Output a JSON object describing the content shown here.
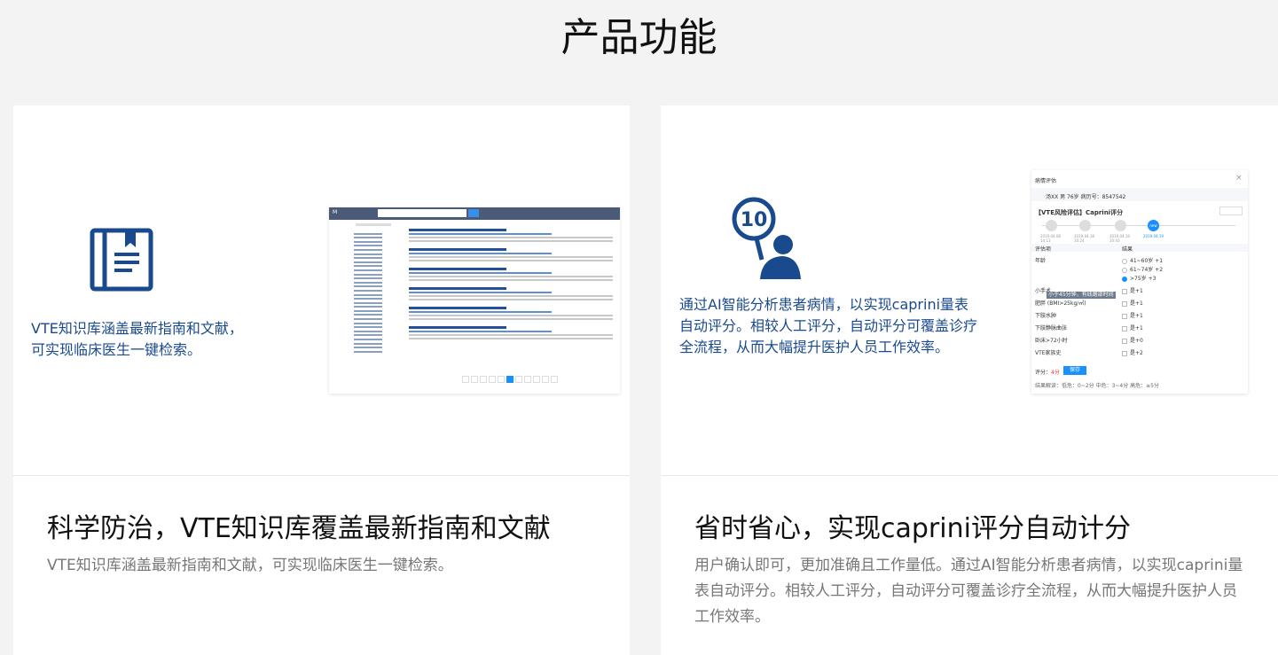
{
  "page": {
    "title": "产品功能"
  },
  "left_card": {
    "hero_text": [
      "VTE知识库涵盖最新指南和文献，",
      "可实现临床医生一键检索。"
    ],
    "heading": "科学防治，VTE知识库覆盖最新指南和文献",
    "description": "VTE知识库涵盖最新指南和文献，可实现临床医生一键检索。",
    "icon": "book-icon"
  },
  "right_card": {
    "hero_text": [
      "通过AI智能分析患者病情，以实现caprini量表",
      "自动评分。相较人工评分，自动评分可覆盖诊疗",
      "全流程，从而大幅提升医护人员工作效率。"
    ],
    "heading": "省时省心，实现caprini评分自动计分",
    "description": "用户确认即可，更加准确且工作量低。通过AI智能分析患者病情，以实现caprini量表自动评分。相较人工评分，自动评分可覆盖诊疗全流程，从而大幅提升医护人员工作效率。",
    "icon": "score-paddle-icon",
    "icon_number": "10"
  },
  "screenshot_right": {
    "title": "病情评估",
    "close": "×",
    "patient": "汤XX  男  76岁  病历号：8547542",
    "section": "【VTE风险评估】Caprini评分",
    "dates": [
      "2019.04.08\n14:13",
      "2019.04.18\n10:24",
      "2019.04.19\n20:43",
      "2019.04.19"
    ],
    "new_label": "new",
    "col_item": "评估项",
    "col_result": "结果",
    "rows": [
      {
        "item": "年龄",
        "options": [
          "41~60岁 +1",
          "61~74岁 +2",
          ">75岁 +3"
        ]
      },
      {
        "item": "小手术",
        "options": [
          "是+1"
        ]
      },
      {
        "item": "肥胖 (BMI>25kg/㎡)",
        "options": [
          "是+1"
        ]
      },
      {
        "item": "下肢水肿",
        "options": [
          "是+1"
        ]
      },
      {
        "item": "下肢静脉曲张",
        "options": [
          "是+1"
        ]
      },
      {
        "item": "卧床>72小时",
        "options": [
          "是+0"
        ]
      },
      {
        "item": "VTE家族史",
        "options": [
          "是+2"
        ]
      }
    ],
    "tooltip": "小于45分钟，有线路部时间",
    "score_label": "评分：",
    "score_value": "4分",
    "save_label": "保存",
    "result_text": "结果解读：低危：0~2分  中危：3~4分  高危：≥5分"
  },
  "colors": {
    "brand_blue": "#1a4a8e",
    "accent": "#1890ff"
  }
}
